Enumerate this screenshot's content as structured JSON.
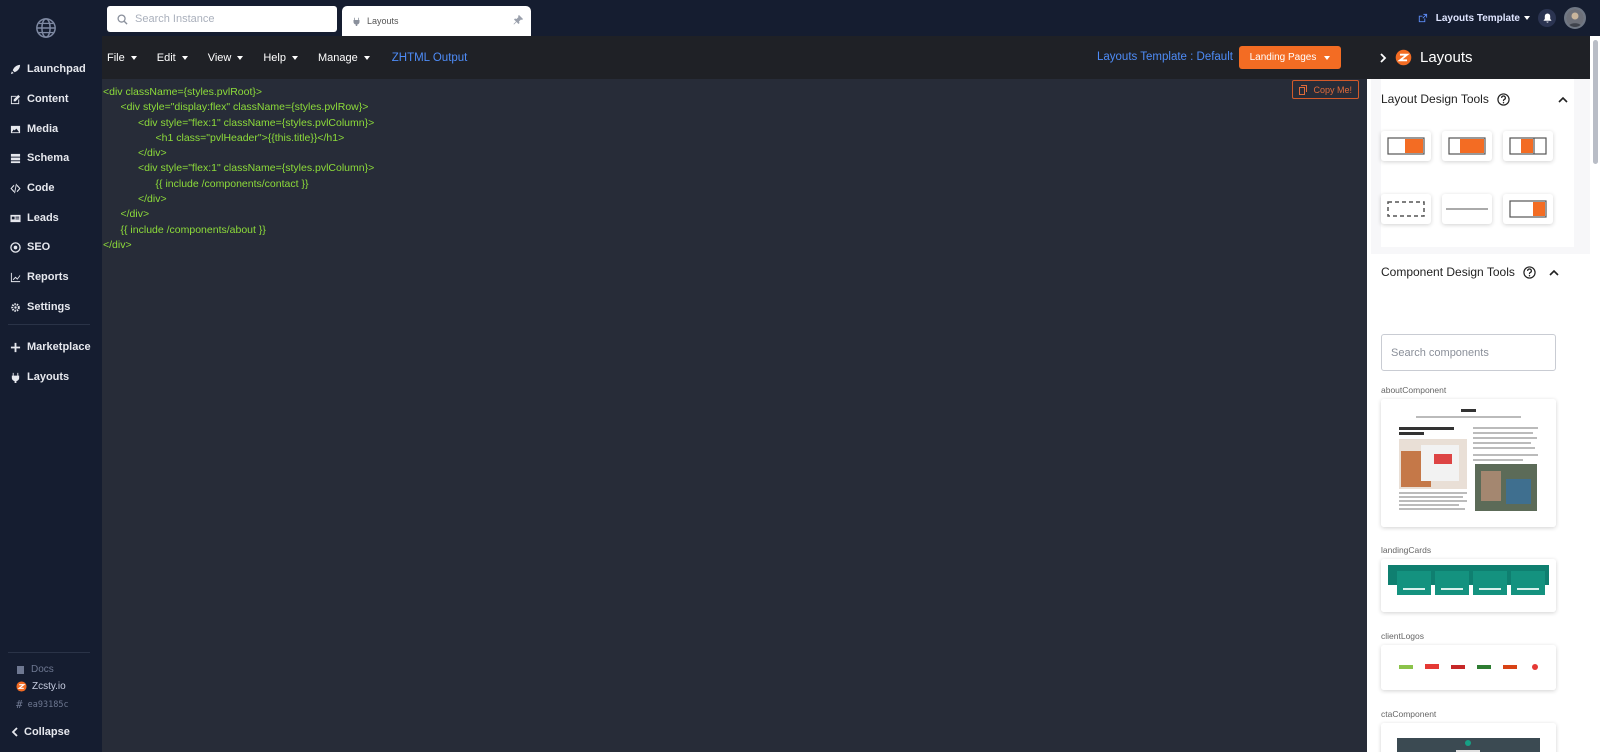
{
  "search": {
    "placeholder": "Search Instance"
  },
  "tab": {
    "label": "Layouts"
  },
  "top_right": {
    "template_label": "Layouts Template"
  },
  "sidebar": {
    "items": [
      {
        "label": "Launchpad",
        "icon": "rocket-icon"
      },
      {
        "label": "Content",
        "icon": "edit-icon"
      },
      {
        "label": "Media",
        "icon": "image-icon"
      },
      {
        "label": "Schema",
        "icon": "database-icon"
      },
      {
        "label": "Code",
        "icon": "code-icon"
      },
      {
        "label": "Leads",
        "icon": "id-card-icon"
      },
      {
        "label": "SEO",
        "icon": "target-icon"
      },
      {
        "label": "Reports",
        "icon": "chart-icon"
      },
      {
        "label": "Settings",
        "icon": "gear-icon"
      },
      {
        "label": "Marketplace",
        "icon": "plus-icon"
      },
      {
        "label": "Layouts",
        "icon": "plug-icon"
      }
    ],
    "footer": {
      "docs": "Docs",
      "brand": "Zcsty.io",
      "hash": "ea93185c"
    },
    "collapse": "Collapse"
  },
  "toolbar": {
    "menus": [
      "File",
      "Edit",
      "View",
      "Help",
      "Manage"
    ],
    "zhtml": "ZHTML Output",
    "template_info": "Layouts Template : Default",
    "landing_button": "Landing Pages"
  },
  "editor": {
    "copy_button": "Copy Me!",
    "lines": [
      "<div className={styles.pvlRoot}>",
      "      <div style=\"display:flex\" className={styles.pvlRow}>",
      "            <div style=\"flex:1\" className={styles.pvlColumn}>",
      "                  <h1 class=\"pvlHeader\">{{this.title}}</h1>",
      "            </div>",
      "            <div style=\"flex:1\" className={styles.pvlColumn}>",
      "                  {{ include /components/contact }}",
      "            </div>",
      "      </div>",
      "      {{ include /components/about }}",
      "</div>"
    ]
  },
  "panel": {
    "title": "Layouts",
    "layout_tools": "Layout Design Tools",
    "component_tools": "Component Design Tools",
    "search_placeholder": "Search components",
    "components": [
      "aboutComponent",
      "landingCards",
      "clientLogos",
      "ctaComponent"
    ]
  },
  "colors": {
    "accent": "#f36c23",
    "link": "#4e8cf7",
    "code": "#8ddc3a",
    "sidebar": "#151d30"
  }
}
